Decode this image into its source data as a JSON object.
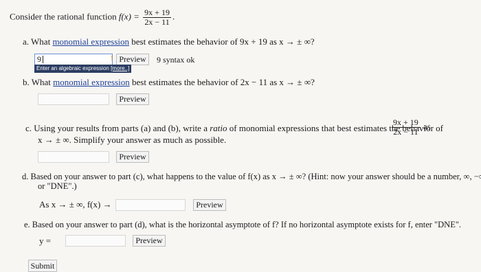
{
  "intro": {
    "text": "Consider the rational function",
    "fn": "f(x) =",
    "num": "9x + 19",
    "den": "2x − 11",
    "period": "."
  },
  "a": {
    "prefix": "a. What",
    "link": "monomial expression",
    "rest": "best estimates the behavior of 9x + 19 as x → ± ∞?",
    "input_value": "9",
    "preview": "Preview",
    "syntax": "9 syntax ok",
    "help_text": "Enter an algebraic expression",
    "help_more": "[more..]"
  },
  "b": {
    "prefix": "b. What",
    "link": "monomial expression",
    "rest": "best estimates the behavior of 2x − 11 as x → ± ∞?",
    "input_value": "",
    "preview": "Preview"
  },
  "c": {
    "line1": "c. Using your results from parts (a) and (b), write a",
    "ratio": "ratio",
    "line1b": "of monomial expressions that best estimates the behavior of",
    "num": "9x + 19",
    "den": "2x − 11",
    "as": "as",
    "line2": "x → ± ∞. Simplify your answer as much as possible.",
    "input_value": "",
    "preview": "Preview"
  },
  "d": {
    "line1": "d. Based on your answer to part (c), what happens to the value of f(x) as x → ± ∞? (Hint: now your answer should be a number, ∞, −∞,",
    "line2": "or \"DNE\".)",
    "label": "As x → ± ∞, f(x) →",
    "input_value": "",
    "preview": "Preview"
  },
  "e": {
    "line1": "e. Based on your answer to part (d), what is the horizontal asymptote of f? If no horizontal asymptote exists for f, enter \"DNE\".",
    "label": "y =",
    "input_value": "",
    "preview": "Preview"
  },
  "submit": "Submit"
}
